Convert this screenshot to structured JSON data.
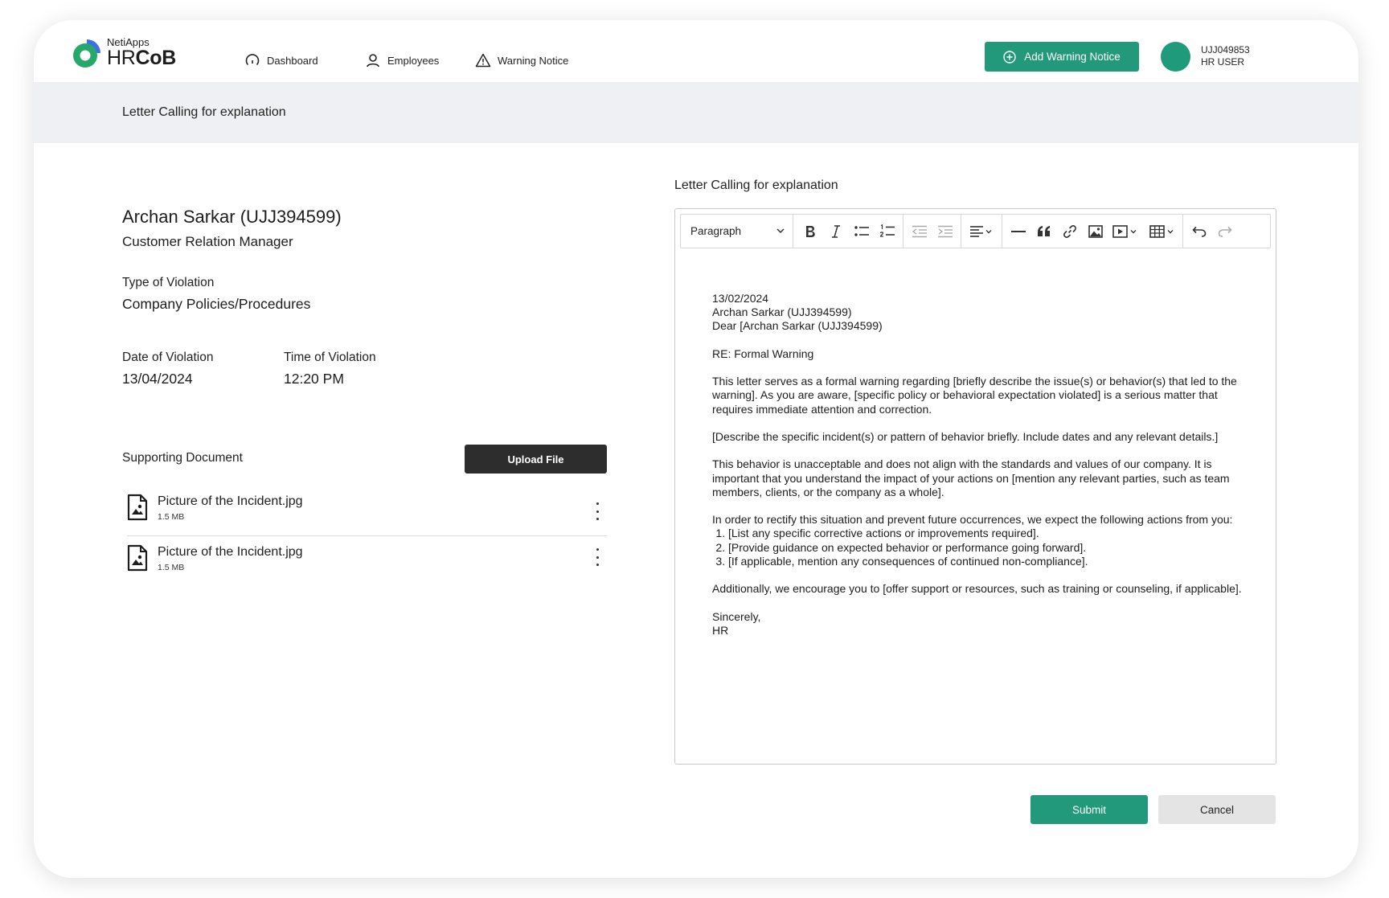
{
  "brand": {
    "top": "NetiApps",
    "main_prefix": "HR",
    "main_bold": "CoB"
  },
  "nav": [
    {
      "label": "Dashboard",
      "icon": "gauge-icon"
    },
    {
      "label": "Employees",
      "icon": "person-icon"
    },
    {
      "label": "Warning Notice",
      "icon": "warning-triangle-icon"
    }
  ],
  "header": {
    "add_button": "Add Warning Notice",
    "user_id": "UJJ049853",
    "user_role": "HR USER"
  },
  "page_title": "Letter Calling for explanation",
  "employee": {
    "name": "Archan Sarkar (UJJ394599)",
    "role": "Customer Relation Manager",
    "violation_type_label": "Type of Violation",
    "violation_type": "Company Policies/Procedures",
    "date_label": "Date of Violation",
    "date": "13/04/2024",
    "time_label": "Time of Violation",
    "time": "12:20 PM"
  },
  "documents": {
    "label": "Supporting Document",
    "upload_button": "Upload File",
    "files": [
      {
        "name": "Picture of the Incident.jpg",
        "size": "1.5 MB"
      },
      {
        "name": "Picture of the Incident.jpg",
        "size": "1.5 MB"
      }
    ]
  },
  "editor": {
    "title": "Letter Calling for explanation",
    "paragraph_style": "Paragraph",
    "letter": {
      "date": "13/02/2024",
      "recipient": "Archan Sarkar (UJJ394599)",
      "salutation": "Dear [Archan Sarkar (UJJ394599)",
      "subject": "RE: Formal Warning",
      "para1": "This letter serves as a formal warning regarding [briefly describe the issue(s) or behavior(s) that led to the warning]. As you are aware, [specific policy or behavioral expectation violated] is a serious matter that requires immediate attention and correction.",
      "para2": "[Describe the specific incident(s) or pattern of behavior briefly. Include dates and any relevant details.]",
      "para3": "This behavior is unacceptable and does not align with the standards and values of our company. It is important that you understand the impact of your actions on [mention any relevant parties, such as team members, clients, or the company as a whole].",
      "para4": "In order to rectify this situation and prevent future occurrences, we expect the following actions from you:",
      "actions": [
        "[List any specific corrective actions or improvements required].",
        "[Provide guidance on expected behavior or performance going forward].",
        "[If applicable, mention any consequences of continued non-compliance]."
      ],
      "para5": "Additionally, we encourage you to [offer support or resources, such as training or counseling, if applicable].",
      "closing": "Sincerely,",
      "signature": "HR"
    }
  },
  "actions": {
    "submit": "Submit",
    "cancel": "Cancel"
  },
  "colors": {
    "accent": "#22997a",
    "dark_button": "#2d2d2d",
    "subheader_bg": "#eef0f3",
    "logo_blue": "#3b6ee8",
    "logo_green": "#26a86a"
  }
}
